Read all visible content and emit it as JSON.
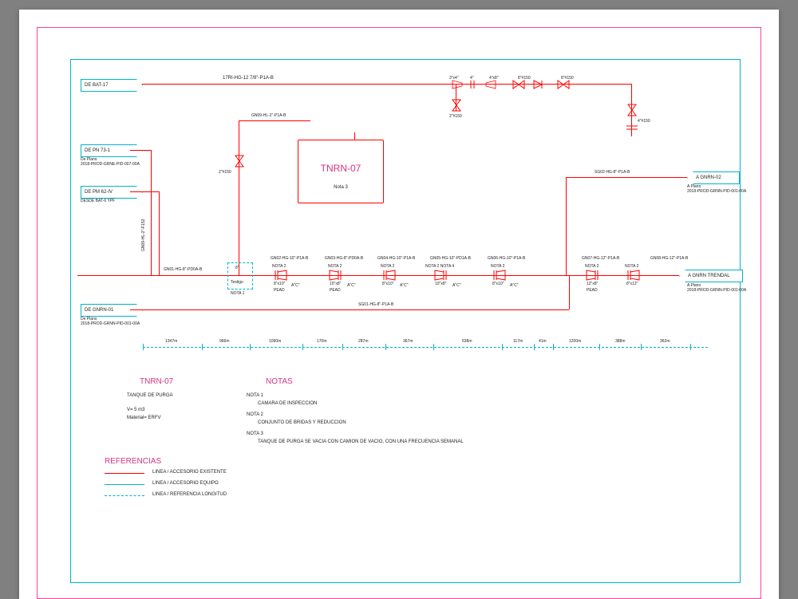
{
  "tank": {
    "id": "TNRN-07",
    "note": "Nota 3"
  },
  "left_tags": {
    "deBat17": "DE BAT-17",
    "dePn73": "DE PN 73-1",
    "dePn73_sub1": "De Plano",
    "dePn73_sub2": "2018-PROD-GRNE-PID-007-00A",
    "dePm62": "DE PM 62-IV",
    "dePm62_sub": "DESDE BAT-6 YPF",
    "deGnrn": "DE GNRN-01",
    "deGnrn_sub1": "De Plano",
    "deGnrn_sub2": "2018-PROD-GRNN-PID-001-00A"
  },
  "right_tags": {
    "aGnrn": "A GNRN-02",
    "aGnrn_sub1": "A Plano",
    "aGnrn_sub2": "2018-PROD-GRNN-PID-001-00A",
    "aGnrnTrend": "A GNRN TRENDAL",
    "aGnrnTrend_sub1": "A Plano",
    "aGnrnTrend_sub2": "2018-PROD-GRNN-PID-001-00A"
  },
  "top_line": {
    "label": "17RI-HG-12 7/8\"-P1A-B",
    "sizes": {
      "s1": "3\"x4\"",
      "s2": "4\"",
      "s3": "4\"x8\"",
      "s4": "8\"#150",
      "s5": "8\"#150"
    },
    "vert1": "2\"#150",
    "vert2": "4\"#150"
  },
  "tank_line": {
    "label": "GN09-HL-2\"-P1A-B",
    "size": "2\"#150"
  },
  "vertical_main": {
    "label": "GN09-HL-2\"-F153"
  },
  "main_line": {
    "start": "GN01-HG-8\"-PD0A-B",
    "segments": [
      {
        "tag": "GN02-HG-10\"-P1A-B",
        "note": "NOTA 2",
        "size": "8\"x10\"",
        "mat": "PEAD",
        "flag": "A\"C\""
      },
      {
        "tag": "GN03-HG-8\"-PD0A-B",
        "note": "NOTA 2",
        "size": "10\"x8\"",
        "mat": "PEAD",
        "flag": "A\"C\""
      },
      {
        "tag": "GN04-HG-10\"-P1A-B",
        "note": "NOTA 2",
        "size": "8\"x10\"",
        "mat": "",
        "flag": "A\"C\""
      },
      {
        "tag": "GN05-HG-10\"-PD1A-B",
        "note": "NOTA 2 NOTA 4",
        "size": "10\"x8\"",
        "mat": "",
        "flag": "A\"C\""
      },
      {
        "tag": "GN06-HG-10\"-P1A-B",
        "note": "NOTA 2",
        "size": "8\"x10\"",
        "mat": "",
        "flag": "A\"C\""
      },
      {
        "tag": "GN07-HG-12\"-P1A-B",
        "note": "NOTA 2",
        "size": "12\"x8\"",
        "mat": "PEAD",
        "flag": ""
      },
      {
        "tag": "GN08-HG-12\"-P1A-B",
        "note": "NOTA 2",
        "size": "8\"x12\"",
        "mat": "",
        "flag": ""
      }
    ],
    "right_branch": "SG02-HG-8\"-P1A-B",
    "bottom_return": "SG01-HG-8\"-P1A-B"
  },
  "testigo": {
    "size": "8\"",
    "label": "Testigo",
    "note": "NOTA 1"
  },
  "distances": [
    "1347m",
    "966m",
    "1090m",
    "170m",
    "287m",
    "367m",
    "638m",
    "117m",
    "41m",
    "1200m",
    "388m",
    "362m"
  ],
  "info_block": {
    "title": "TNRN-07",
    "desc": "TANQUE DE PURGA",
    "vol": "V= 5 m3",
    "mat": "Material= ERFV"
  },
  "notas": {
    "header": "NOTAS",
    "n1h": "NOTA 1",
    "n1t": "CAMARA DE INSPECCION",
    "n2h": "NOTA 2",
    "n2t": "CONJUNTO DE BRIDAS Y REDUCCION",
    "n3h": "NOTA 3",
    "n3t": "TANQUE DE PURGA SE VACIA CON CAMION DE VACIO, CON UNA FRECUENCIA SEMANAL"
  },
  "references": {
    "header": "REFERENCIAS",
    "r1": "LINEA / ACCESORIO EXISTENTE",
    "r2": "LINEA / ACCESORIO EQUIPO",
    "r3": "LINEA / REFERENCIA LONGITUD"
  }
}
